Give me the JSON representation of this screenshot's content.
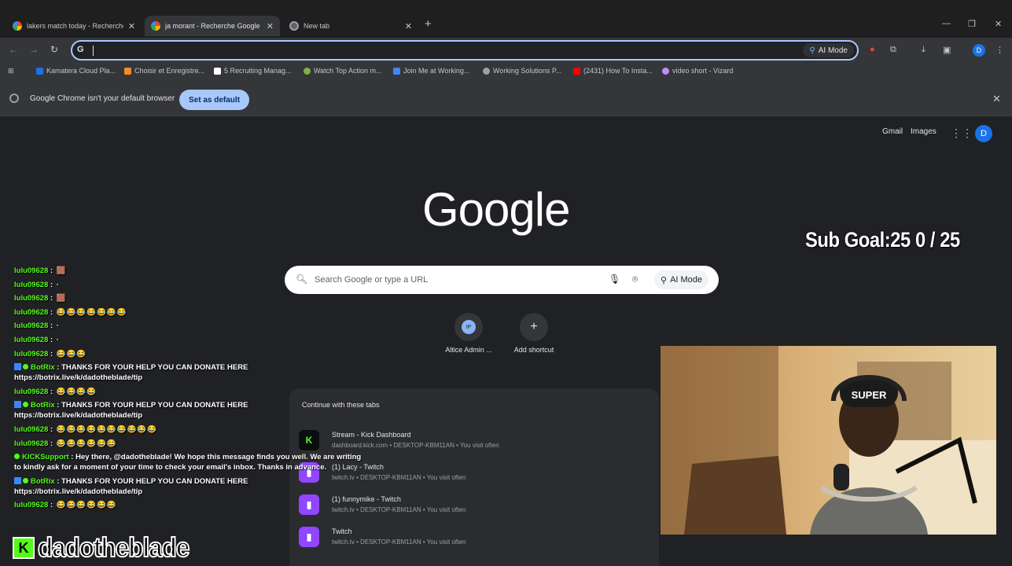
{
  "tabs": [
    {
      "title": "lakers match today - Recherche Google",
      "close": "✕"
    },
    {
      "title": "ja morant - Recherche Google",
      "close": "✕"
    },
    {
      "title": "New tab",
      "close": "✕"
    }
  ],
  "omnibox": {
    "ai_mode": "AI Mode"
  },
  "bookmarks": [
    {
      "label": "Kamatera Cloud Pla...",
      "color": "#1a73e8"
    },
    {
      "label": "Choisir et Enregistre...",
      "color": "#f28b25"
    },
    {
      "label": "5 Recruiting Manag...",
      "color": "#ffffff"
    },
    {
      "label": "Watch Top Action m...",
      "color": "#7cb342"
    },
    {
      "label": "Join Me at Working...",
      "color": "#4285f4"
    },
    {
      "label": "Working Solutions P...",
      "color": "#9aa0a6"
    },
    {
      "label": "(2431) How To Insta...",
      "color": "#ff0000"
    },
    {
      "label": "video short - Vizard",
      "color": "#c58af9"
    }
  ],
  "infobar": {
    "text": "Google Chrome isn't your default browser",
    "button": "Set as default",
    "close": "✕"
  },
  "ntp": {
    "gmail": "Gmail",
    "images": "Images",
    "avatar": "D",
    "logo": "Google",
    "search_placeholder": "Search Google or type a URL",
    "search_ai": "AI Mode",
    "shortcuts": [
      {
        "icon": "IP",
        "label": "Altice Admin ..."
      },
      {
        "icon": "+",
        "label": "Add shortcut"
      }
    ],
    "continue": {
      "title": "Continue with these tabs",
      "items": [
        {
          "name": "Stream - Kick Dashboard",
          "sub": "dashboard.kick.com • DESKTOP-KBM11AN • You visit often"
        },
        {
          "name": "(1) Lacy - Twitch",
          "sub": "twitch.tv • DESKTOP-KBM11AN • You visit often"
        },
        {
          "name": "(1) funnymike - Twitch",
          "sub": "twitch.tv • DESKTOP-KBM11AN • You visit often"
        },
        {
          "name": "Twitch",
          "sub": "twitch.tv • DESKTOP-KBM11AN • You visit often"
        }
      ]
    }
  },
  "overlay": {
    "sub_goal": "Sub Goal:25  0 / 25",
    "streamer": "dadotheblade",
    "webcam_hat": "SUPER"
  },
  "chat": [
    {
      "user": "lulu09628",
      "text": ": 🟫"
    },
    {
      "user": "lulu09628",
      "text": ": ·"
    },
    {
      "user": "lulu09628",
      "text": ": 🟫"
    },
    {
      "user": "lulu09628",
      "text": ": 😂😂😂😂😂😂😂"
    },
    {
      "user": "lulu09628",
      "text": ": ·"
    },
    {
      "user": "lulu09628",
      "text": ": ·"
    },
    {
      "user": "lulu09628",
      "text": ": 😂😂😂"
    },
    {
      "user": "BotRix",
      "text": ": THANKS FOR YOUR HELP YOU CAN DONATE HERE",
      "cont": "https://botrix.live/k/dadotheblade/tip"
    },
    {
      "user": "lulu09628",
      "text": ": 😂😂😂😂"
    },
    {
      "user": "BotRix",
      "text": ": THANKS FOR YOUR HELP YOU CAN DONATE HERE",
      "cont": "https://botrix.live/k/dadotheblade/tip"
    },
    {
      "user": "lulu09628",
      "text": ": 😂😂😂😂😂😂😂😂😂😂"
    },
    {
      "user": "lulu09628",
      "text": ": 😂😂😂😂😂😂"
    },
    {
      "user": "KICKSupport",
      "text": ": Hey there, @dadotheblade! We hope this message finds you well. We are writing",
      "cont": "to kindly ask for a moment of your time to check your email's inbox. Thanks in advance."
    },
    {
      "user": "BotRix",
      "text": ": THANKS FOR YOUR HELP YOU CAN DONATE HERE",
      "cont": "https://botrix.live/k/dadotheblade/tip"
    },
    {
      "user": "lulu09628",
      "text": ": 😂😂😂😂😂😂"
    }
  ]
}
